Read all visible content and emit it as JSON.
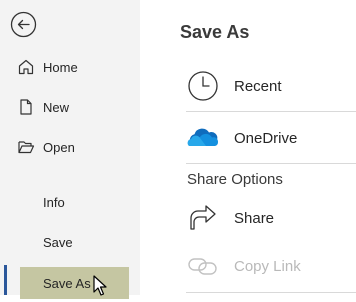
{
  "sidebar": {
    "back_icon": "back-arrow-icon",
    "items": [
      {
        "label": "Home",
        "icon": "home-icon"
      },
      {
        "label": "New",
        "icon": "new-document-icon"
      },
      {
        "label": "Open",
        "icon": "open-folder-icon"
      }
    ],
    "plain_items": [
      {
        "label": "Info"
      },
      {
        "label": "Save"
      }
    ],
    "active_item": {
      "label": "Save As"
    }
  },
  "main": {
    "title": "Save As",
    "locations": [
      {
        "label": "Recent",
        "icon": "clock-icon"
      },
      {
        "label": "OneDrive",
        "icon": "onedrive-cloud-icon"
      }
    ],
    "share_heading": "Share Options",
    "share_items": [
      {
        "label": "Share",
        "icon": "share-arrow-icon",
        "enabled": true
      },
      {
        "label": "Copy Link",
        "icon": "link-icon",
        "enabled": false
      }
    ]
  },
  "colors": {
    "sidebar_bg": "#f3f3f3",
    "active_bg": "#c5c6a2",
    "accent": "#2b579a",
    "onedrive_blue": "#0f6cbd"
  }
}
